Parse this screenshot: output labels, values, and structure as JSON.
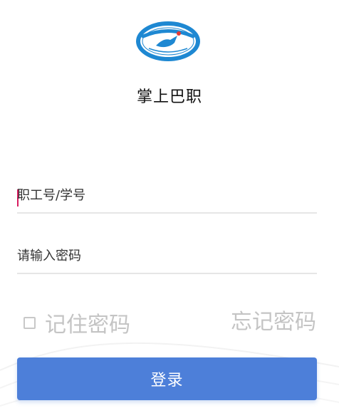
{
  "app": {
    "title": "掌上巴职"
  },
  "login_form": {
    "username_placeholder": "职工号/学号",
    "password_placeholder": "请输入密码",
    "remember_label": "记住密码",
    "remember_checked": false,
    "forgot_label": "忘记密码",
    "login_button_label": "登录"
  },
  "colors": {
    "primary_button": "#4d7fd9",
    "caret": "#d81b60",
    "logo_blue": "#1e88d2",
    "muted_text": "#c4c4c4",
    "divider": "#e6e6e6"
  },
  "icons": {
    "logo": "school-seal-logo",
    "checkbox": "checkbox-unchecked-icon"
  }
}
